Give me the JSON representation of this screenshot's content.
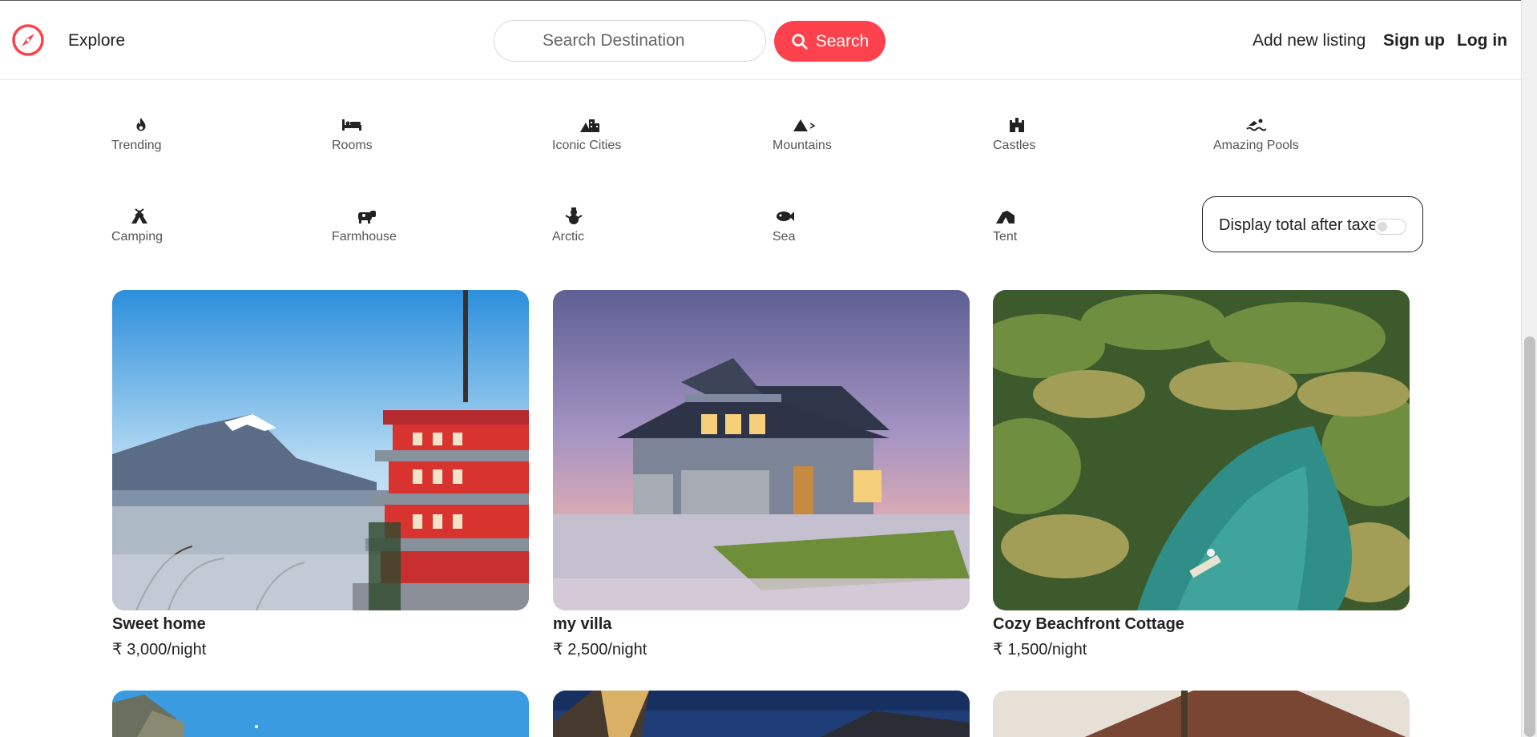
{
  "brand": {
    "accent_color": "#fe424d",
    "logo_icon": "compass-icon"
  },
  "navbar": {
    "explore_label": "Explore",
    "search_placeholder": "Search Destination",
    "search_button_label": "Search",
    "search_icon": "magnifier-icon",
    "add_listing_label": "Add new listing",
    "signup_label": "Sign up",
    "login_label": "Log in"
  },
  "filters": [
    {
      "label": "Trending",
      "icon": "fire-icon"
    },
    {
      "label": "Rooms",
      "icon": "bed-icon"
    },
    {
      "label": "Iconic Cities",
      "icon": "city-icon"
    },
    {
      "label": "Mountains",
      "icon": "mountain-icon"
    },
    {
      "label": "Castles",
      "icon": "castle-icon"
    },
    {
      "label": "Amazing Pools",
      "icon": "swimmer-icon"
    },
    {
      "label": "Camping",
      "icon": "tent-camp-icon"
    },
    {
      "label": "Farmhouse",
      "icon": "cow-icon"
    },
    {
      "label": "Arctic",
      "icon": "snowman-icon"
    },
    {
      "label": "Sea",
      "icon": "fish-icon"
    },
    {
      "label": "Tent",
      "icon": "tent-icon"
    }
  ],
  "tax_toggle": {
    "label": "Display total after taxes",
    "enabled": false
  },
  "listings": [
    {
      "title": "Sweet home",
      "price": "₹ 3,000/night"
    },
    {
      "title": "my villa",
      "price": "₹ 2,500/night"
    },
    {
      "title": "Cozy Beachfront Cottage",
      "price": "₹ 1,500/night"
    }
  ]
}
